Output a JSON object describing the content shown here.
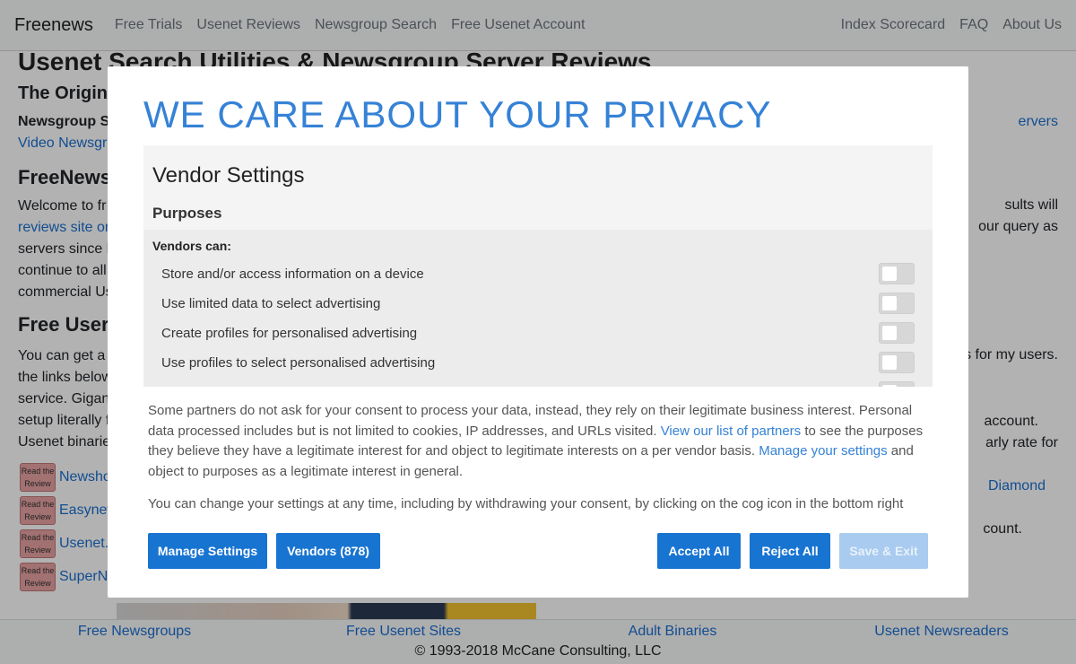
{
  "navbar": {
    "brand": "Freenews",
    "left_links": [
      "Free Trials",
      "Usenet Reviews",
      "Newsgroup Search",
      "Free Usenet Account"
    ],
    "right_links": [
      "Index Scorecard",
      "FAQ",
      "About Us"
    ]
  },
  "background": {
    "h1": "Usenet Search Utilities & Newsgroup Server Reviews",
    "h2_original": "The Origina",
    "bold_line": "Newsgroup S",
    "video_link": "Video Newsgr",
    "servers_link": "ervers",
    "h2_freenews": "FreeNews",
    "welcome_lines": [
      "Welcome to fr",
      "reviews site or",
      "servers since b",
      "continue to all",
      "commercial Us"
    ],
    "welcome_right": [
      "sults will",
      "our query as"
    ],
    "h2_free_usenet": "Free User",
    "free_lines": [
      "You can get a",
      "the links below",
      "service. Gigane",
      "setup literally f",
      "Usenet binarie"
    ],
    "free_right": [
      "s for my users.",
      "account.",
      "arly rate for"
    ],
    "reviews": [
      {
        "badge": "Read the Review",
        "link": "Newsho"
      },
      {
        "badge": "Read the Review",
        "link": "Easynew"
      },
      {
        "badge": "Read the Review",
        "link": "Usenet.r"
      },
      {
        "badge": "Read the Review",
        "link": "SuperN"
      }
    ],
    "diamond_link": "Diamond",
    "account_frag": "count."
  },
  "footer": {
    "links": [
      "Free Newsgroups",
      "Free Usenet Sites",
      "Adult Binaries",
      "Usenet Newsreaders"
    ],
    "copyright": "© 1993-2018 McCane Consulting, LLC"
  },
  "modal": {
    "title": "WE CARE ABOUT YOUR PRIVACY",
    "vendor_settings": "Vendor Settings",
    "purposes": "Purposes",
    "vendors_can": "Vendors can:",
    "purpose_items": [
      {
        "label": "Store and/or access information on a device",
        "enabled": false
      },
      {
        "label": "Use limited data to select advertising",
        "enabled": false
      },
      {
        "label": "Create profiles for personalised advertising",
        "enabled": false
      },
      {
        "label": "Use profiles to select personalised advertising",
        "enabled": false
      }
    ],
    "consent_text_1": "Some partners do not ask for your consent to process your data, instead, they rely on their legitimate business interest. Personal data processed includes but is not limited to cookies, IP addresses, and URLs visited. ",
    "partners_link": "View our list of partners",
    "consent_text_2": " to see the purposes they believe they have a legitimate interest for and object to legitimate interests on a per vendor basis. ",
    "manage_link": "Manage your settings",
    "consent_text_3": " and object to purposes as a legitimate interest in general.",
    "change_text": "You can change your settings at any time, including by withdrawing your consent, by clicking on the cog icon in the bottom right",
    "buttons": {
      "manage_settings": "Manage Settings",
      "vendors": "Vendors (878)",
      "accept_all": "Accept All",
      "reject_all": "Reject All",
      "save_exit": "Save & Exit"
    }
  },
  "colors": {
    "accent": "#1874d1",
    "title_blue": "#3582d6",
    "disabled_button": "#a9cbef",
    "link_blue": "#1a6fd0"
  }
}
